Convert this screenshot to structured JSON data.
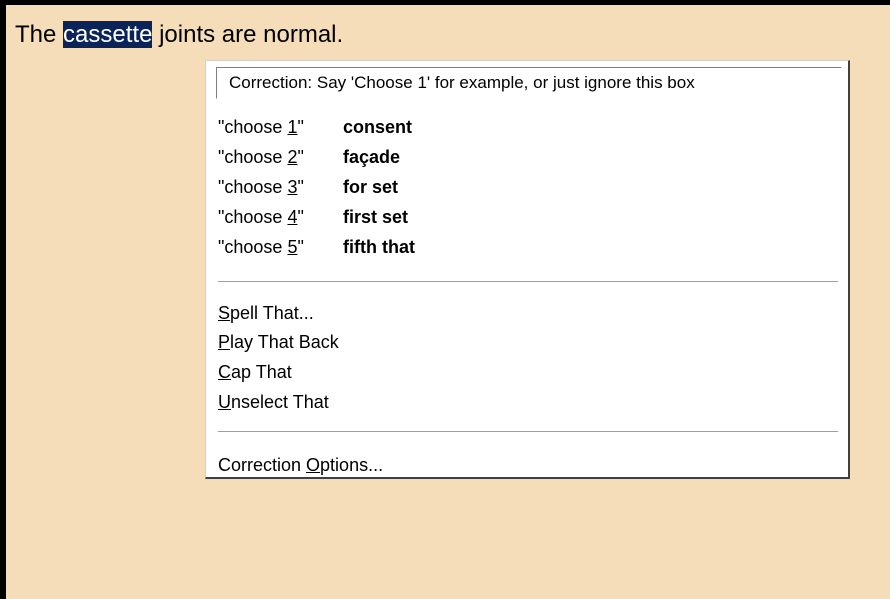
{
  "document": {
    "before": "The ",
    "selected": "cassette",
    "after": " joints are normal.",
    "background": "#f6ddb9",
    "selection_color": "#0a2459"
  },
  "correction_menu": {
    "hint": "Correction: Say 'Choose 1' for example, or just ignore this box",
    "choices": [
      {
        "cmd_prefix": "\"choose ",
        "number": "1",
        "cmd_suffix": "\"",
        "word": "consent"
      },
      {
        "cmd_prefix": "\"choose ",
        "number": "2",
        "cmd_suffix": "\"",
        "word": "façade"
      },
      {
        "cmd_prefix": "\"choose ",
        "number": "3",
        "cmd_suffix": "\"",
        "word": "for set"
      },
      {
        "cmd_prefix": "\"choose ",
        "number": "4",
        "cmd_suffix": "\"",
        "word": "first set"
      },
      {
        "cmd_prefix": "\"choose ",
        "number": "5",
        "cmd_suffix": "\"",
        "word": "fifth that"
      }
    ],
    "commands": [
      {
        "mnemonic": "S",
        "rest": "pell That..."
      },
      {
        "mnemonic": "P",
        "rest": "lay That Back"
      },
      {
        "mnemonic": "C",
        "rest": "ap That"
      },
      {
        "mnemonic": "U",
        "rest": "nselect That"
      }
    ],
    "options": {
      "before": "Correction ",
      "mnemonic": "O",
      "after": "ptions..."
    }
  }
}
